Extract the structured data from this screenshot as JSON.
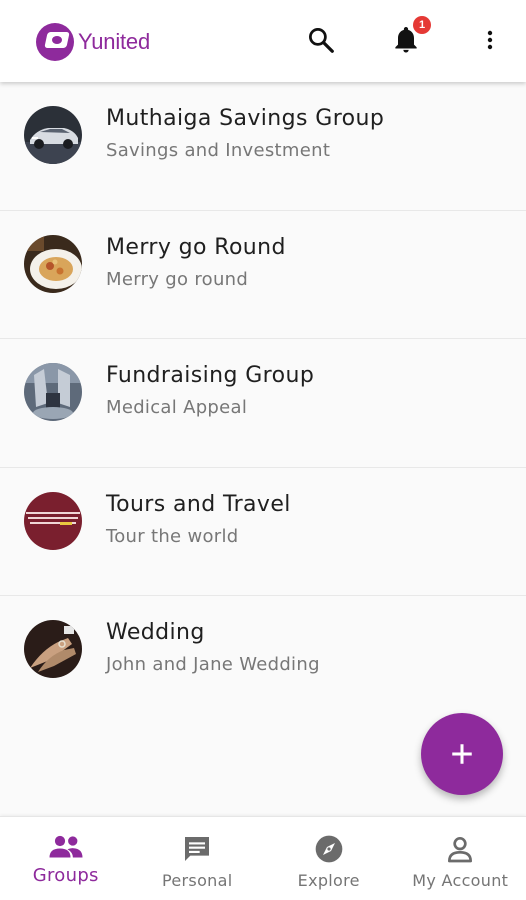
{
  "app": {
    "name": "Yunited",
    "brand_color": "#8e2a9c",
    "notification_count": "1"
  },
  "toolbar": {
    "icons": [
      "search-icon",
      "notification-bell-icon",
      "more-vert-icon"
    ]
  },
  "groups": [
    {
      "name": "Muthaiga Savings Group",
      "subtitle": "Savings and Investment",
      "avatar": "car-photo"
    },
    {
      "name": "Merry go Round",
      "subtitle": "Merry go round",
      "avatar": "food-plate-photo"
    },
    {
      "name": "Fundraising Group",
      "subtitle": "Medical Appeal",
      "avatar": "hospital-photo"
    },
    {
      "name": "Tours and Travel",
      "subtitle": "Tour the world",
      "avatar": "maroon-text-banner"
    },
    {
      "name": "Wedding",
      "subtitle": "John and Jane Wedding",
      "avatar": "hands-rings-photo"
    }
  ],
  "fab": {
    "icon": "add-icon",
    "symbol": "+"
  },
  "bottom_nav": {
    "items": [
      {
        "label": "Groups",
        "icon": "people-icon",
        "active": true
      },
      {
        "label": "Personal",
        "icon": "chat-icon",
        "active": false
      },
      {
        "label": "Explore",
        "icon": "compass-icon",
        "active": false
      },
      {
        "label": "My Account",
        "icon": "person-icon",
        "active": false
      }
    ]
  }
}
